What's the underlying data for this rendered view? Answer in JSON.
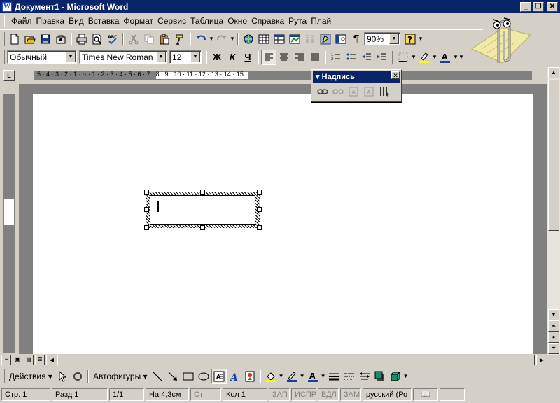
{
  "window": {
    "title": "Документ1 - Microsoft Word",
    "icon_letter": "W"
  },
  "menu": [
    "Файл",
    "Правка",
    "Вид",
    "Вставка",
    "Формат",
    "Сервис",
    "Таблица",
    "Окно",
    "Справка",
    "Рута",
    "Плай"
  ],
  "standard_toolbar": {
    "zoom": "90%"
  },
  "formatting_toolbar": {
    "style": "Обычный",
    "font": "Times New Roman",
    "size": "12",
    "bold": "Ж",
    "italic": "К",
    "underline": "Ч"
  },
  "ruler": {
    "numbers": "5 · 4 · 3 · 2 · 1 · ⌂ · 1 · 2 · 3 · 4 · 5 · 6 · 7 · 8 · 9 · 10 · 11 · 12 · 13 · 14 · 15",
    "tab_selector": "L"
  },
  "floating_toolbar": {
    "title": "Надпись"
  },
  "drawing_toolbar": {
    "actions": "Действия ▾",
    "autoshapes": "Автофигуры ▾"
  },
  "statusbar": {
    "page": "Стр.  1",
    "section": "Разд  1",
    "pages": "1/1",
    "at": "На 4,3см",
    "line": "Ст",
    "col": "Кол  1",
    "rec": "ЗАП",
    "trk": "ИСПР",
    "ext": "ВДЛ",
    "ovr": "ЗАМ",
    "lang": "русский (Ро"
  },
  "colors": {
    "titlebar": "#0a246a",
    "chrome": "#d4d0c8",
    "workspace": "#808080"
  }
}
